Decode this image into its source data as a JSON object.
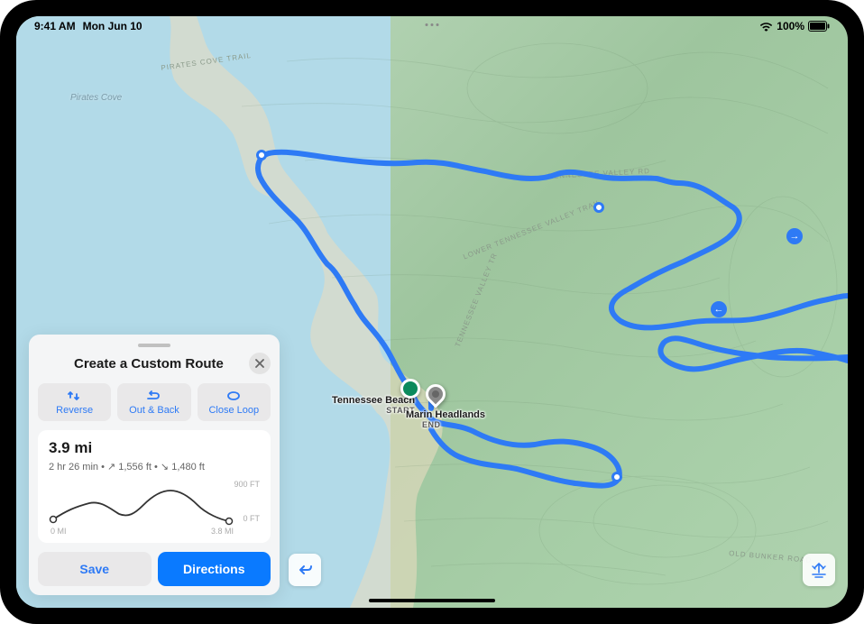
{
  "status": {
    "time": "9:41 AM",
    "date": "Mon Jun 10",
    "battery": "100%"
  },
  "map": {
    "labels": {
      "pirates_cove": "Pirates Cove",
      "pirates_cove_trail": "PIRATES COVE TRAIL",
      "tennessee_valley_rd": "TENNESSEE VALLEY RD",
      "lower_tennessee_trail": "LOWER TENNESSEE VALLEY TRAIL",
      "tennessee_valley_tr": "TENNESSEE VALLEY TR",
      "old_bunker_road": "OLD BUNKER ROAD"
    },
    "poi": {
      "start_label": "Tennessee Beach",
      "start_sub": "START",
      "end_label": "Marin Headlands",
      "end_sub": "END"
    }
  },
  "card": {
    "title": "Create a Custom Route",
    "actions": {
      "reverse": "Reverse",
      "out_back": "Out & Back",
      "close_loop": "Close Loop"
    },
    "stats": {
      "distance": "3.9 mi",
      "details": "2 hr 26 min  •  ↗ 1,556 ft  •  ↘ 1,480 ft"
    },
    "elevation": {
      "y_max": "900 FT",
      "y_min": "0 FT",
      "x_min": "0 MI",
      "x_max": "3.8 MI"
    },
    "buttons": {
      "save": "Save",
      "directions": "Directions"
    }
  }
}
